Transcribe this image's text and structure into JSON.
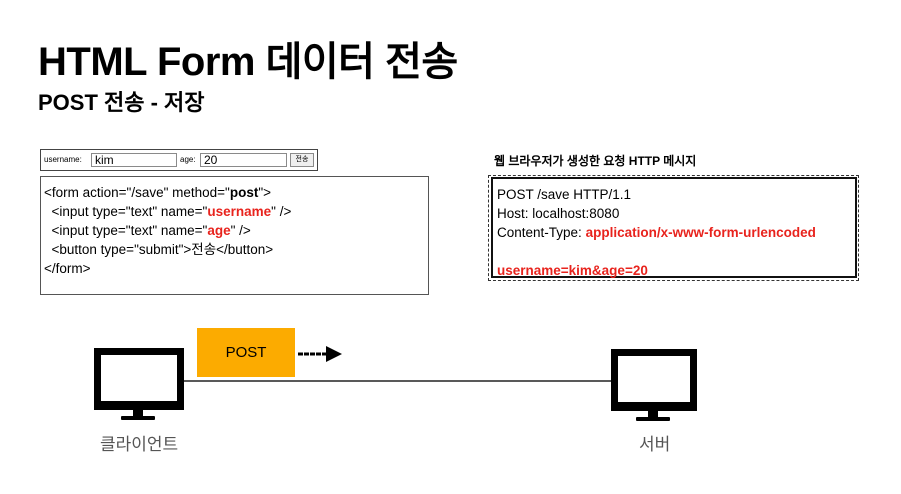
{
  "title": "HTML Form 데이터 전송",
  "subtitle": "POST 전송 - 저장",
  "form_preview": {
    "username_label": "username:",
    "username_value": "kim",
    "age_label": "age:",
    "age_value": "20",
    "submit_label": "전송"
  },
  "html_code": {
    "line1_a": "<form action=\"/save\" method=\"",
    "line1_b": "post",
    "line1_c": "\">",
    "line2_a": "  <input type=\"text\" name=\"",
    "line2_b": "username",
    "line2_c": "\" />",
    "line3_a": "  <input type=\"text\" name=\"",
    "line3_b": "age",
    "line3_c": "\" />",
    "line4": "  <button type=\"submit\">전송</button>",
    "line5": "</form>"
  },
  "http_message": {
    "caption": "웹 브라우저가 생성한 요청 HTTP 메시지",
    "request_line": "POST /save HTTP/1.1",
    "host_line": "Host: localhost:8080",
    "content_type_label": "Content-Type: ",
    "content_type_value": "application/x-www-form-urlencoded",
    "body": "username=kim&age=20"
  },
  "flow": {
    "method_label": "POST",
    "client_label": "클라이언트",
    "server_label": "서버"
  },
  "colors": {
    "highlight": "#e8231d",
    "post_tag": "#fcab00"
  }
}
